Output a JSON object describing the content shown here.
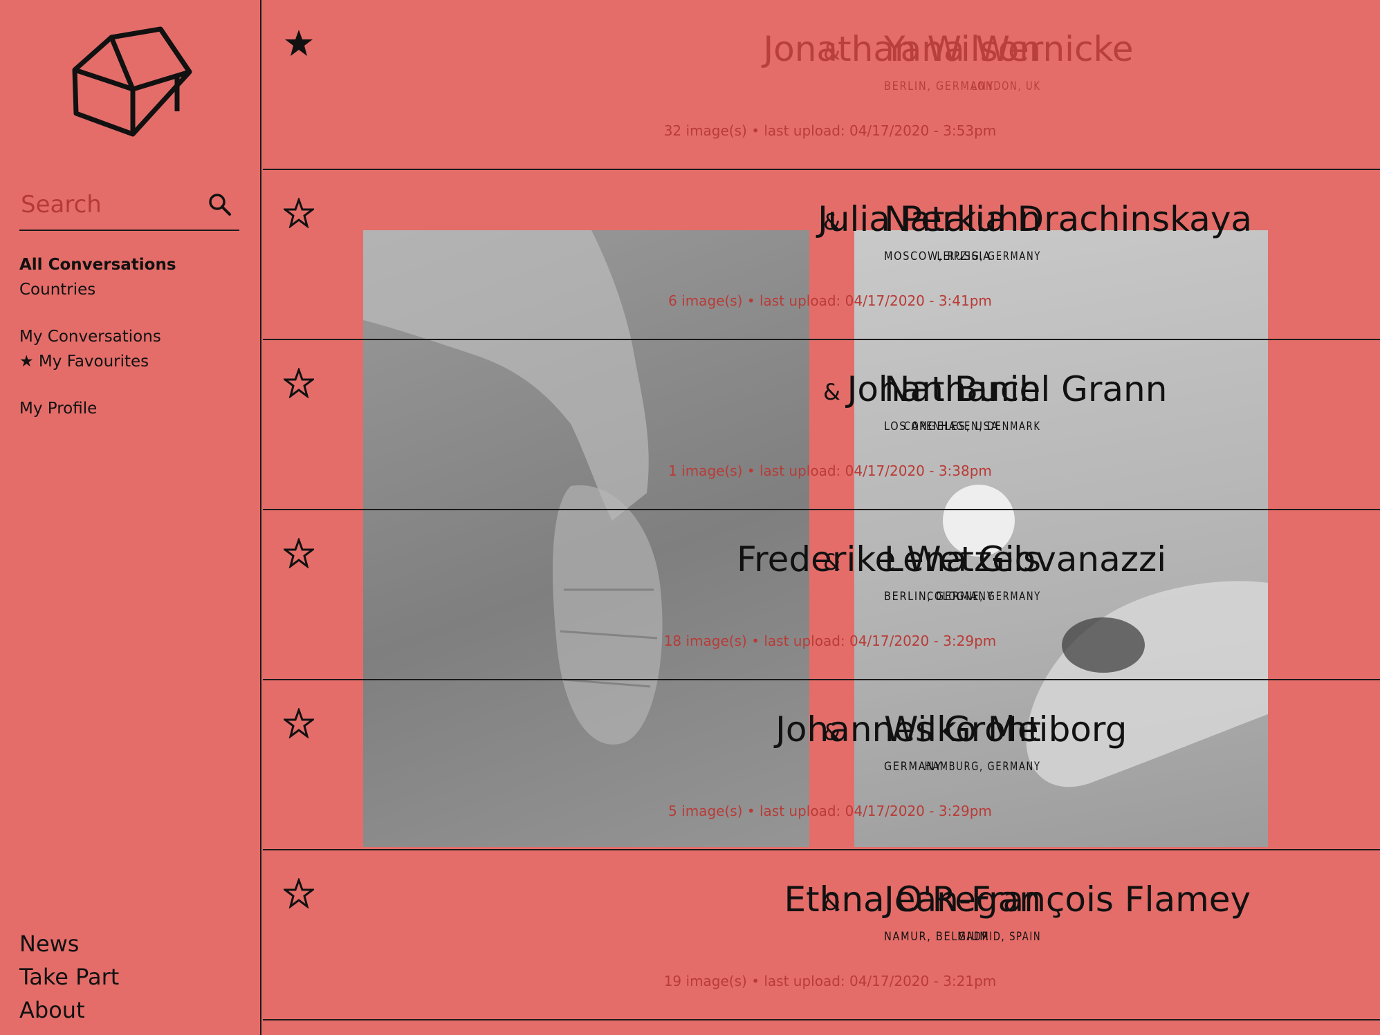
{
  "sidebar": {
    "logo": "house-logo",
    "search": {
      "placeholder": "Search"
    },
    "nav_primary": [
      {
        "label": "All Conversations",
        "active": true
      },
      {
        "label": "Countries",
        "active": false
      }
    ],
    "nav_secondary": [
      {
        "label": "My Conversations"
      },
      {
        "label": "★ My Favourites"
      }
    ],
    "nav_profile": [
      {
        "label": "My Profile"
      }
    ],
    "nav_bottom": [
      {
        "label": "News"
      },
      {
        "label": "Take Part"
      },
      {
        "label": "About"
      }
    ]
  },
  "conversations": [
    {
      "favourite": true,
      "left_name": "Jonathan Wilson",
      "left_location": "LONDON, UK",
      "right_name": "Yana Wernicke",
      "right_location": "BERLIN, GERMANY",
      "meta": "32 image(s) • last upload: 04/17/2020 - 3:53pm"
    },
    {
      "favourite": false,
      "left_name": "Julia Perkuhn",
      "left_location": "LEIPZIG, GERMANY",
      "right_name": "Natalia Drachinskaya",
      "right_location": "MOSCOW, RUSSIA",
      "meta": "6 image(s) • last upload: 04/17/2020 - 3:41pm"
    },
    {
      "favourite": false,
      "left_name": "Johan Buch",
      "left_location": "COPENHAGEN, DENMARK",
      "right_name": "Nathaniel Grann",
      "right_location": "LOS ANGELES, USA",
      "meta": "1 image(s) • last upload: 04/17/2020 - 3:38pm"
    },
    {
      "favourite": false,
      "left_name": "Frederike Wetzels",
      "left_location": "COLOGNE, GERMANY",
      "right_name": "Lena Giovanazzi",
      "right_location": "BERLIN, GERMANY",
      "meta": "18 image(s) • last upload: 04/17/2020 - 3:29pm"
    },
    {
      "favourite": false,
      "left_name": "Johannes Groht",
      "left_location": "HAMBURG, GERMANY",
      "right_name": "Wilko Meiborg",
      "right_location": "GERMANY",
      "meta": "5 image(s) • last upload: 04/17/2020 - 3:29pm"
    },
    {
      "favourite": false,
      "left_name": "Ethna O'Regan",
      "left_location": "MADRID, SPAIN",
      "right_name": "Jean-François Flamey",
      "right_location": "NAMUR, BELGIUM",
      "meta": "19 image(s) • last upload: 04/17/2020 - 3:21pm"
    }
  ],
  "amp": "&",
  "colors": {
    "background": "#e46d69",
    "muted_text": "#b93b37",
    "ink": "#111111"
  }
}
